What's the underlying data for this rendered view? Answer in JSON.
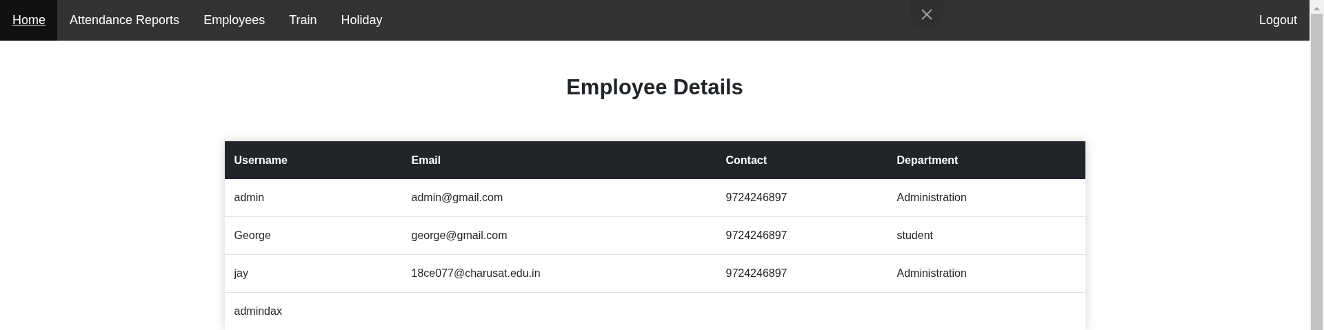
{
  "navbar": {
    "items": [
      {
        "label": "Home",
        "selected": true
      },
      {
        "label": "Attendance Reports",
        "selected": false
      },
      {
        "label": "Employees",
        "selected": false
      },
      {
        "label": "Train",
        "selected": false
      },
      {
        "label": "Holiday",
        "selected": false
      }
    ],
    "logout": "Logout"
  },
  "page_title": "Employee Details",
  "table": {
    "columns": [
      "Username",
      "Email",
      "Contact",
      "Department"
    ],
    "rows": [
      [
        "admin",
        "admin@gmail.com",
        "9724246897",
        "Administration"
      ],
      [
        "George",
        "george@gmail.com",
        "9724246897",
        "student"
      ],
      [
        "jay",
        "18ce077@charusat.edu.in",
        "9724246897",
        "Administration"
      ],
      [
        "admindax",
        "",
        "",
        ""
      ]
    ]
  }
}
